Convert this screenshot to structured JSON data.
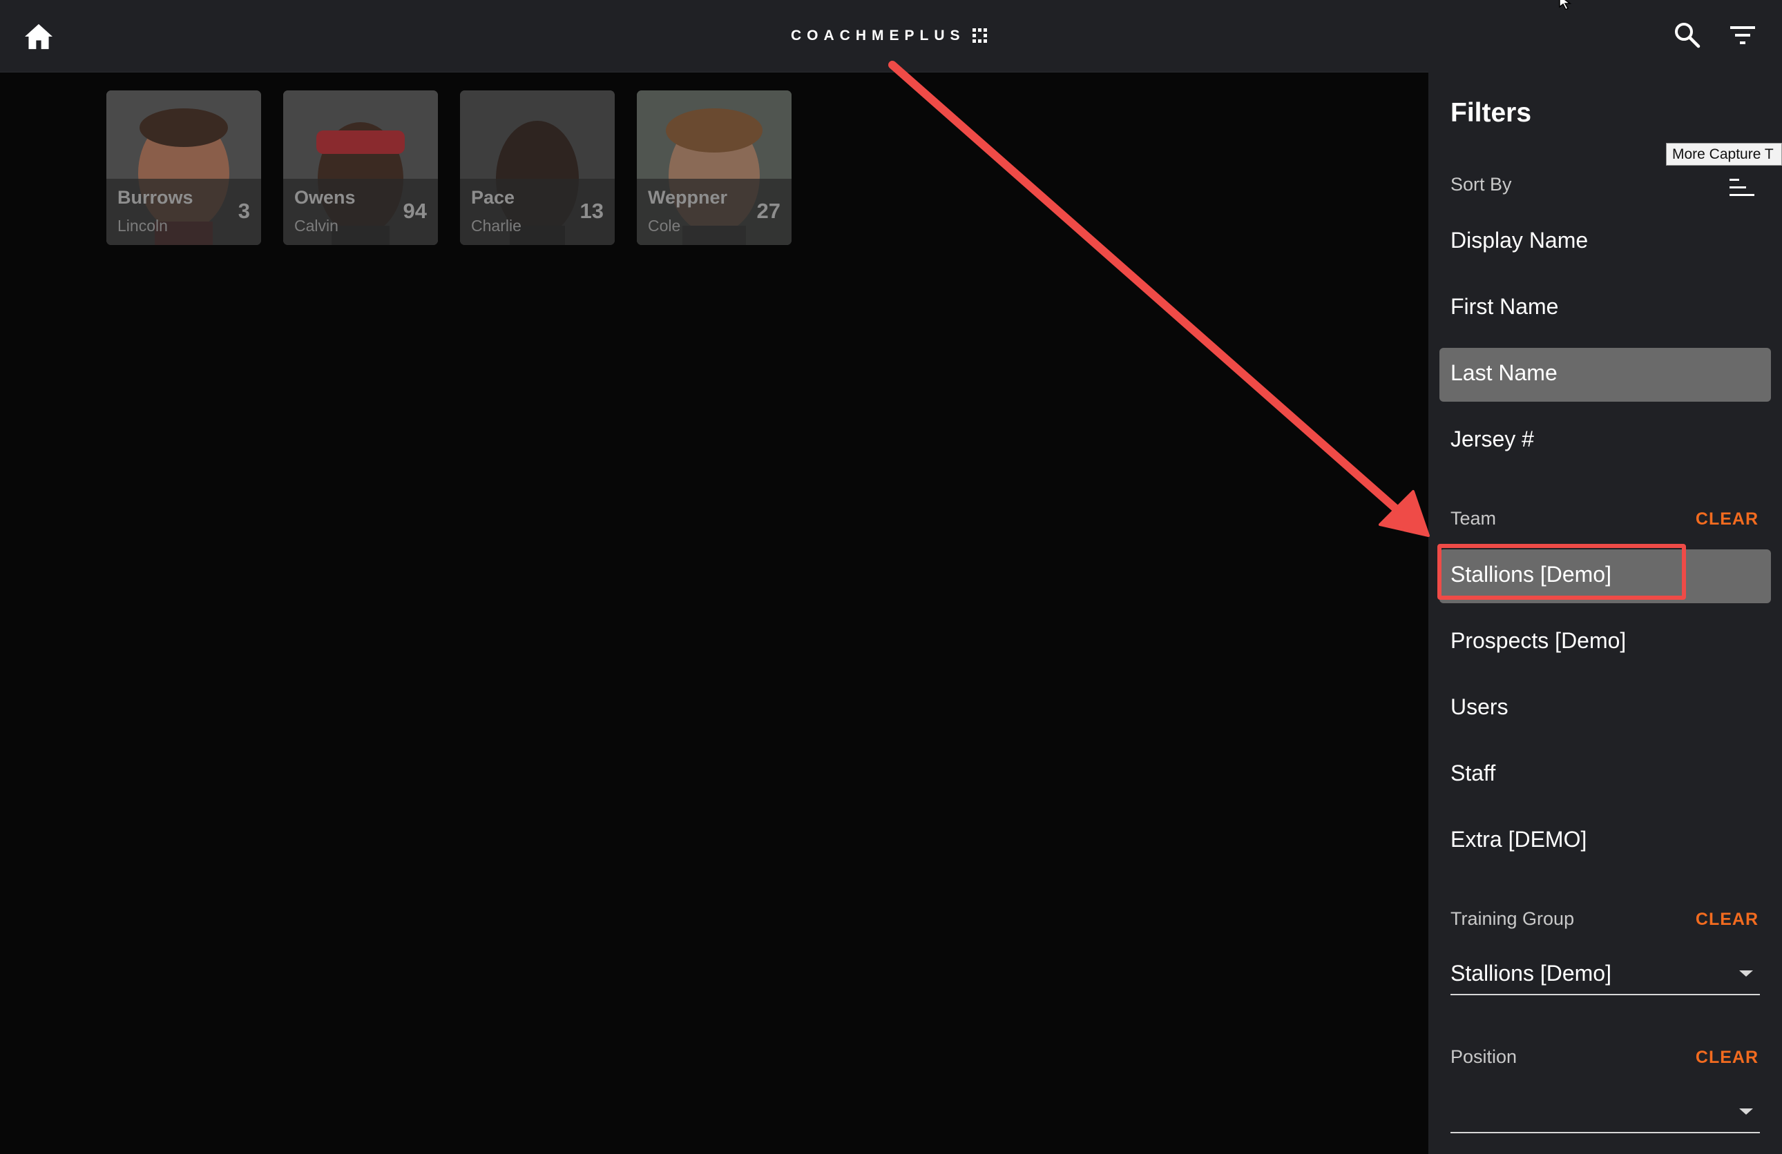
{
  "app": {
    "logo_text": "COACHMEPLUS",
    "home_icon": "home-icon",
    "search_icon": "search-icon",
    "filter_icon": "filter-icon"
  },
  "athletes": [
    {
      "last": "Burrows",
      "first": "Lincoln",
      "number": "3"
    },
    {
      "last": "Owens",
      "first": "Calvin",
      "number": "94"
    },
    {
      "last": "Pace",
      "first": "Charlie",
      "number": "13"
    },
    {
      "last": "Weppner",
      "first": "Cole",
      "number": "27"
    }
  ],
  "filters": {
    "title": "Filters",
    "tooltip": "More Capture T",
    "sort_by": {
      "label": "Sort By",
      "options": [
        "Display Name",
        "First Name",
        "Last Name",
        "Jersey #"
      ],
      "selected": "Last Name"
    },
    "team": {
      "label": "Team",
      "clear": "CLEAR",
      "options": [
        "Stallions [Demo]",
        "Prospects [Demo]",
        "Users",
        "Staff",
        "Extra [DEMO]"
      ],
      "selected": "Stallions [Demo]"
    },
    "training_group": {
      "label": "Training Group",
      "clear": "CLEAR",
      "value": "Stallions [Demo]"
    },
    "position": {
      "label": "Position",
      "clear": "CLEAR",
      "value": ""
    }
  },
  "colors": {
    "accent": "#f26b1f",
    "annotation": "#ef4b47",
    "panel_bg": "#202125",
    "selected_bg": "#6a6a6a"
  }
}
